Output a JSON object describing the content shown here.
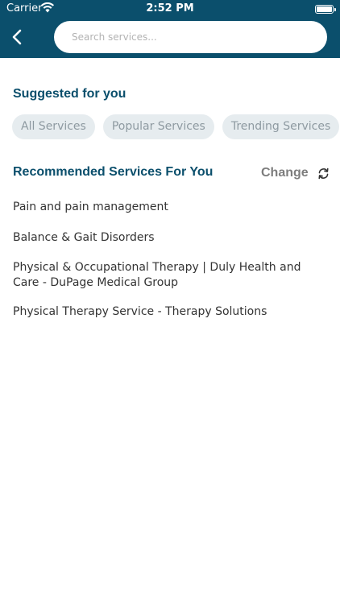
{
  "status_bar": {
    "carrier": "Carrier",
    "time": "2:52 PM"
  },
  "header": {
    "back_icon": "chevron-left-icon",
    "search_placeholder": "Search services...",
    "search_value": ""
  },
  "suggested": {
    "title": "Suggested for you",
    "chips": [
      {
        "label": "All Services"
      },
      {
        "label": "Popular Services"
      },
      {
        "label": "Trending Services"
      }
    ]
  },
  "recommended": {
    "title": "Recommended Services For You",
    "change_label": "Change",
    "change_icon": "refresh-icon",
    "items": [
      {
        "label": "Pain and pain management"
      },
      {
        "label": "Balance & Gait Disorders"
      },
      {
        "label": "Physical & Occupational Therapy | Duly Health and Care - DuPage Medical Group"
      },
      {
        "label": "Physical Therapy Service - Therapy Solutions"
      }
    ]
  },
  "colors": {
    "header_bg": "#0b4f6c",
    "title_text": "#0b4f6c",
    "chip_bg": "#e6ecef",
    "chip_text": "#8e9aa1",
    "change_text": "#7d7d7d",
    "body_text": "#333333"
  }
}
